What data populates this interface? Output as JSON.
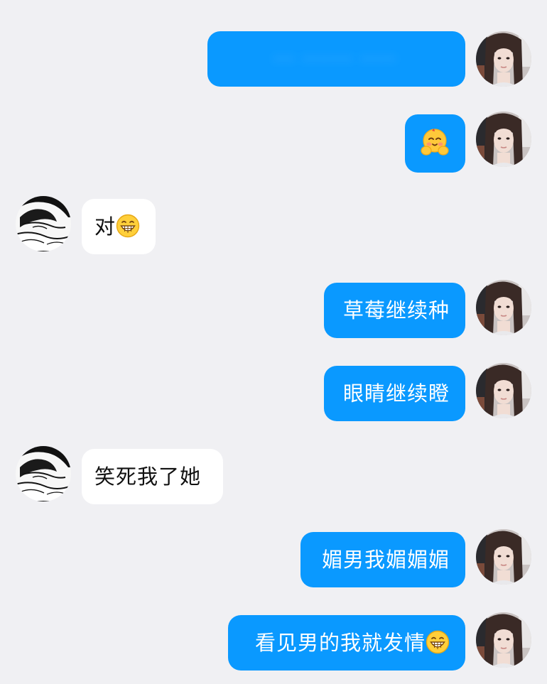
{
  "chat": {
    "messages": [
      {
        "side": "sent",
        "text": "··· ······· ·····",
        "blurred": true
      },
      {
        "side": "sent",
        "text": "",
        "emoji": "hug-emoji"
      },
      {
        "side": "received",
        "text": "对",
        "emoji": "grin-emoji"
      },
      {
        "side": "sent",
        "text": "草莓继续种"
      },
      {
        "side": "sent",
        "text": "眼睛继续瞪"
      },
      {
        "side": "received",
        "text": "笑死我了她"
      },
      {
        "side": "sent",
        "text": "媚男我媚媚媚"
      },
      {
        "side": "sent",
        "text": "看见男的我就发情",
        "emoji": "grin-emoji"
      }
    ],
    "colors": {
      "background": "#f0f0f3",
      "sent_bubble": "#0a99ff",
      "received_bubble": "#ffffff",
      "sent_text": "#ffffff",
      "received_text": "#111111"
    },
    "avatars": {
      "self": "girl-portrait-avatar",
      "other": "manga-sleeping-avatar"
    }
  }
}
